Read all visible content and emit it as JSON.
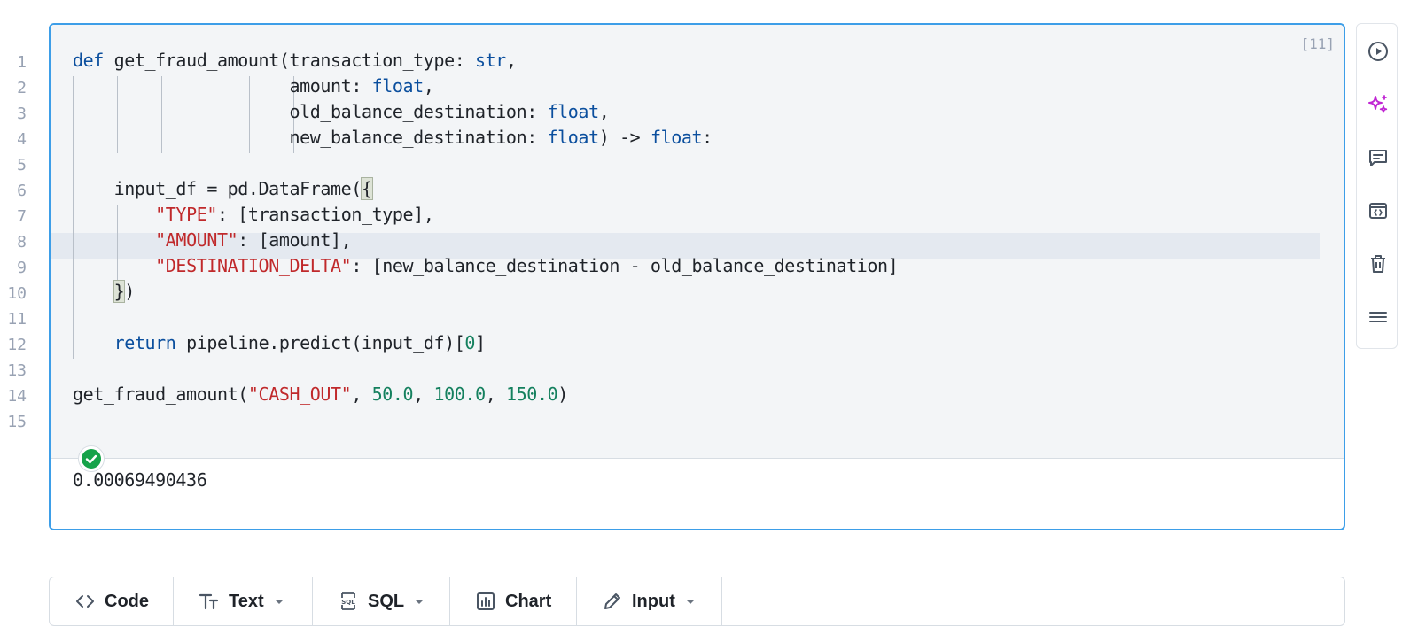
{
  "cell": {
    "execution_count": "[11]",
    "line_numbers": [
      "1",
      "2",
      "3",
      "4",
      "5",
      "6",
      "7",
      "8",
      "9",
      "10",
      "11",
      "12",
      "13",
      "14",
      "15"
    ],
    "output": "0.00069490436",
    "code": {
      "l1": {
        "kw": "def",
        "fn": " get_fraud_amount(transaction_type: ",
        "type": "str",
        "end": ","
      },
      "l2": {
        "pad": "                     ",
        "name": "amount: ",
        "type": "float",
        "end": ","
      },
      "l3": {
        "pad": "                     ",
        "name": "old_balance_destination: ",
        "type": "float",
        "end": ","
      },
      "l4": {
        "pad": "                     ",
        "name": "new_balance_destination: ",
        "type": "float",
        "arrow": ") -> ",
        "ret_type": "float",
        "end": ":"
      },
      "l6": {
        "pre": "    input_df = pd.DataFrame(",
        "open": "{"
      },
      "l7": {
        "pad": "        ",
        "key": "\"TYPE\"",
        "rest": ": [transaction_type],"
      },
      "l8": {
        "pad": "        ",
        "key": "\"AMOUNT\"",
        "rest": ": [amount],"
      },
      "l9": {
        "pad": "        ",
        "key": "\"DESTINATION_DELTA\"",
        "rest": ": [new_balance_destination - old_balance_destination]"
      },
      "l10": {
        "pad": "    ",
        "close": "}",
        "rest": ")"
      },
      "l12": {
        "pad": "    ",
        "kw": "return",
        "rest": " pipeline.predict(input_df)[",
        "num": "0",
        "end": "]"
      },
      "l14": {
        "pre": "get_fraud_amount(",
        "arg1": "\"CASH_OUT\"",
        "sep1": ", ",
        "arg2": "50.0",
        "sep2": ", ",
        "arg3": "100.0",
        "sep3": ", ",
        "arg4": "150.0",
        "end": ")"
      }
    }
  },
  "side_toolbar": {
    "icons": [
      "run-icon",
      "ai-sparkle-icon",
      "comment-icon",
      "embed-icon",
      "delete-icon",
      "menu-icon"
    ],
    "accent": "#c026d3"
  },
  "add_bar": {
    "code": "Code",
    "text": "Text",
    "sql": "SQL",
    "chart": "Chart",
    "input": "Input"
  },
  "colors": {
    "border_active": "#3d9ee8",
    "keyword": "#0b4f9e",
    "string": "#c0292b",
    "number": "#14805e",
    "success": "#16a34a"
  }
}
